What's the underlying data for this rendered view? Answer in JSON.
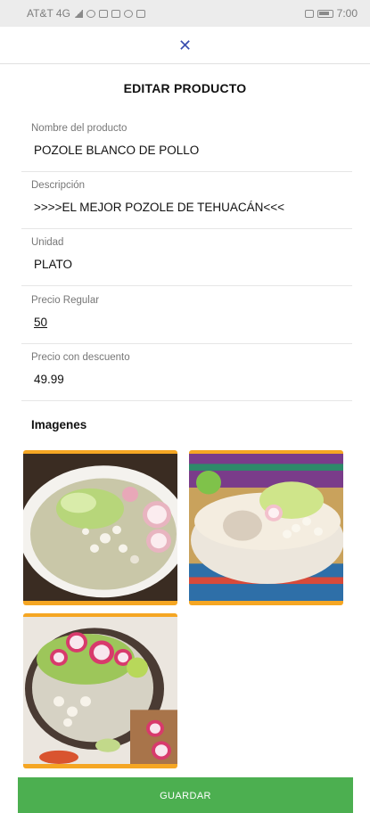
{
  "status_bar": {
    "carrier": "AT&T 4G",
    "time": "7:00"
  },
  "header": {
    "close_icon": "close-icon"
  },
  "page": {
    "title": "EDITAR PRODUCTO"
  },
  "form": {
    "name": {
      "label": "Nombre del producto",
      "value": "POZOLE BLANCO DE POLLO"
    },
    "description": {
      "label": "Descripción",
      "value": ">>>>EL MEJOR POZOLE DE TEHUACÁN<<<"
    },
    "unit": {
      "label": "Unidad",
      "value": "PLATO"
    },
    "regular_price": {
      "label": "Precio Regular",
      "value": "50"
    },
    "discount_price": {
      "label": "Precio con descuento",
      "value": "49.99"
    }
  },
  "images": {
    "title": "Imagenes"
  },
  "actions": {
    "save_label": "GUARDAR"
  },
  "colors": {
    "accent_orange": "#f5a623",
    "save_green": "#4caf50",
    "close_blue": "#3a4fb0"
  }
}
